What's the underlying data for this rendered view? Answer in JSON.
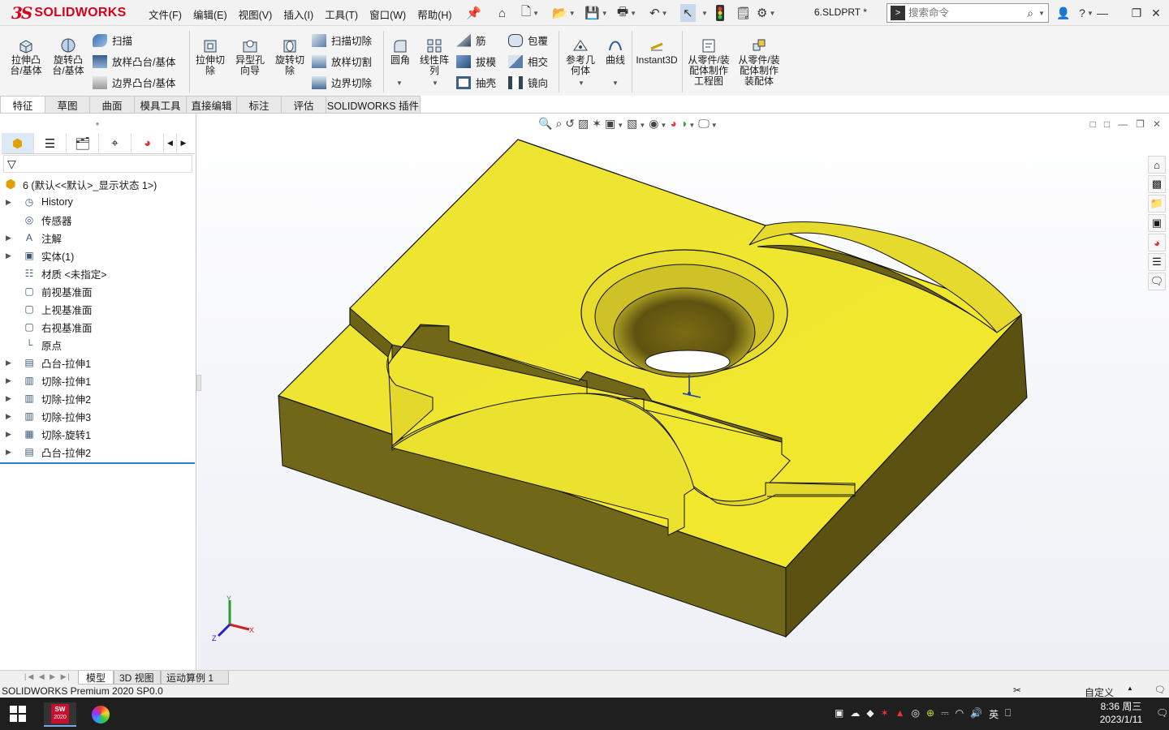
{
  "titlebar": {
    "logo_ds": "3S",
    "logo_text": "SOLIDWORKS",
    "menu": [
      "文件(F)",
      "编辑(E)",
      "视图(V)",
      "插入(I)",
      "工具(T)",
      "窗口(W)",
      "帮助(H)"
    ],
    "document_title": "6.SLDPRT *",
    "search_placeholder": "搜索命令",
    "help_label": "?"
  },
  "command_manager": {
    "big_buttons": [
      {
        "label": "拉伸凸台/基体",
        "icon": "extrude-boss-icon"
      },
      {
        "label": "旋转凸台/基体",
        "icon": "revolve-boss-icon"
      },
      {
        "label": "拉伸切除",
        "icon": "extrude-cut-icon"
      },
      {
        "label": "异型孔向导",
        "icon": "hole-wizard-icon"
      },
      {
        "label": "旋转切除",
        "icon": "revolve-cut-icon"
      },
      {
        "label": "圆角",
        "icon": "fillet-icon"
      },
      {
        "label": "线性阵列",
        "icon": "linear-pattern-icon"
      },
      {
        "label": "参考几何体",
        "icon": "reference-geometry-icon"
      },
      {
        "label": "曲线",
        "icon": "curves-icon"
      },
      {
        "label": "Instant3D",
        "icon": "instant3d-icon"
      },
      {
        "label": "从零件/装配体制作工程图",
        "icon": "make-drawing-icon"
      },
      {
        "label": "从零件/装配体制作装配体",
        "icon": "make-assembly-icon"
      }
    ],
    "small_buttons": [
      {
        "label": "扫描",
        "icon": "sweep-icon"
      },
      {
        "label": "放样凸台/基体",
        "icon": "loft-icon"
      },
      {
        "label": "边界凸台/基体",
        "icon": "boundary-boss-icon"
      },
      {
        "label": "扫描切除",
        "icon": "swept-cut-icon"
      },
      {
        "label": "放样切割",
        "icon": "lofted-cut-icon"
      },
      {
        "label": "边界切除",
        "icon": "boundary-cut-icon"
      },
      {
        "label": "筋",
        "icon": "rib-icon"
      },
      {
        "label": "拔模",
        "icon": "draft-icon"
      },
      {
        "label": "抽壳",
        "icon": "shell-icon"
      },
      {
        "label": "包覆",
        "icon": "wrap-icon"
      },
      {
        "label": "相交",
        "icon": "intersect-icon"
      },
      {
        "label": "镜向",
        "icon": "mirror-icon"
      }
    ]
  },
  "tabs": [
    "特征",
    "草图",
    "曲面",
    "模具工具",
    "直接编辑",
    "标注",
    "评估",
    "SOLIDWORKS 插件"
  ],
  "tree": {
    "root": "6  (默认<<默认>_显示状态 1>)",
    "items": [
      {
        "label": "History",
        "icon": "history-icon",
        "expandable": true
      },
      {
        "label": "传感器",
        "icon": "sensor-icon",
        "expandable": false
      },
      {
        "label": "注解",
        "icon": "annotation-icon",
        "expandable": true
      },
      {
        "label": "实体(1)",
        "icon": "solid-body-icon",
        "expandable": true
      },
      {
        "label": "材质 <未指定>",
        "icon": "material-icon",
        "expandable": false
      },
      {
        "label": "前视基准面",
        "icon": "plane-icon",
        "expandable": false
      },
      {
        "label": "上视基准面",
        "icon": "plane-icon",
        "expandable": false
      },
      {
        "label": "右视基准面",
        "icon": "plane-icon",
        "expandable": false
      },
      {
        "label": "原点",
        "icon": "origin-icon",
        "expandable": false
      },
      {
        "label": "凸台-拉伸1",
        "icon": "boss-extrude-icon",
        "expandable": true
      },
      {
        "label": "切除-拉伸1",
        "icon": "cut-extrude-icon",
        "expandable": true
      },
      {
        "label": "切除-拉伸2",
        "icon": "cut-extrude-icon",
        "expandable": true
      },
      {
        "label": "切除-拉伸3",
        "icon": "cut-extrude-icon",
        "expandable": true
      },
      {
        "label": "切除-旋转1",
        "icon": "cut-revolve-icon",
        "expandable": true
      },
      {
        "label": "凸台-拉伸2",
        "icon": "boss-extrude-icon",
        "expandable": true
      }
    ]
  },
  "viewport": {
    "part_color": "#f2e52a",
    "triad_labels": {
      "x": "X",
      "y": "Y",
      "z": "Z"
    }
  },
  "bottom_tabs": [
    "模型",
    "3D 视图",
    "运动算例 1"
  ],
  "statusbar": {
    "product": "SOLIDWORKS Premium 2020 SP0.0",
    "units": "自定义"
  },
  "taskbar": {
    "sw_badge_top": "SW",
    "sw_badge_year": "2020",
    "ime": "英",
    "time": "8:36 周三",
    "date": "2023/1/11"
  }
}
